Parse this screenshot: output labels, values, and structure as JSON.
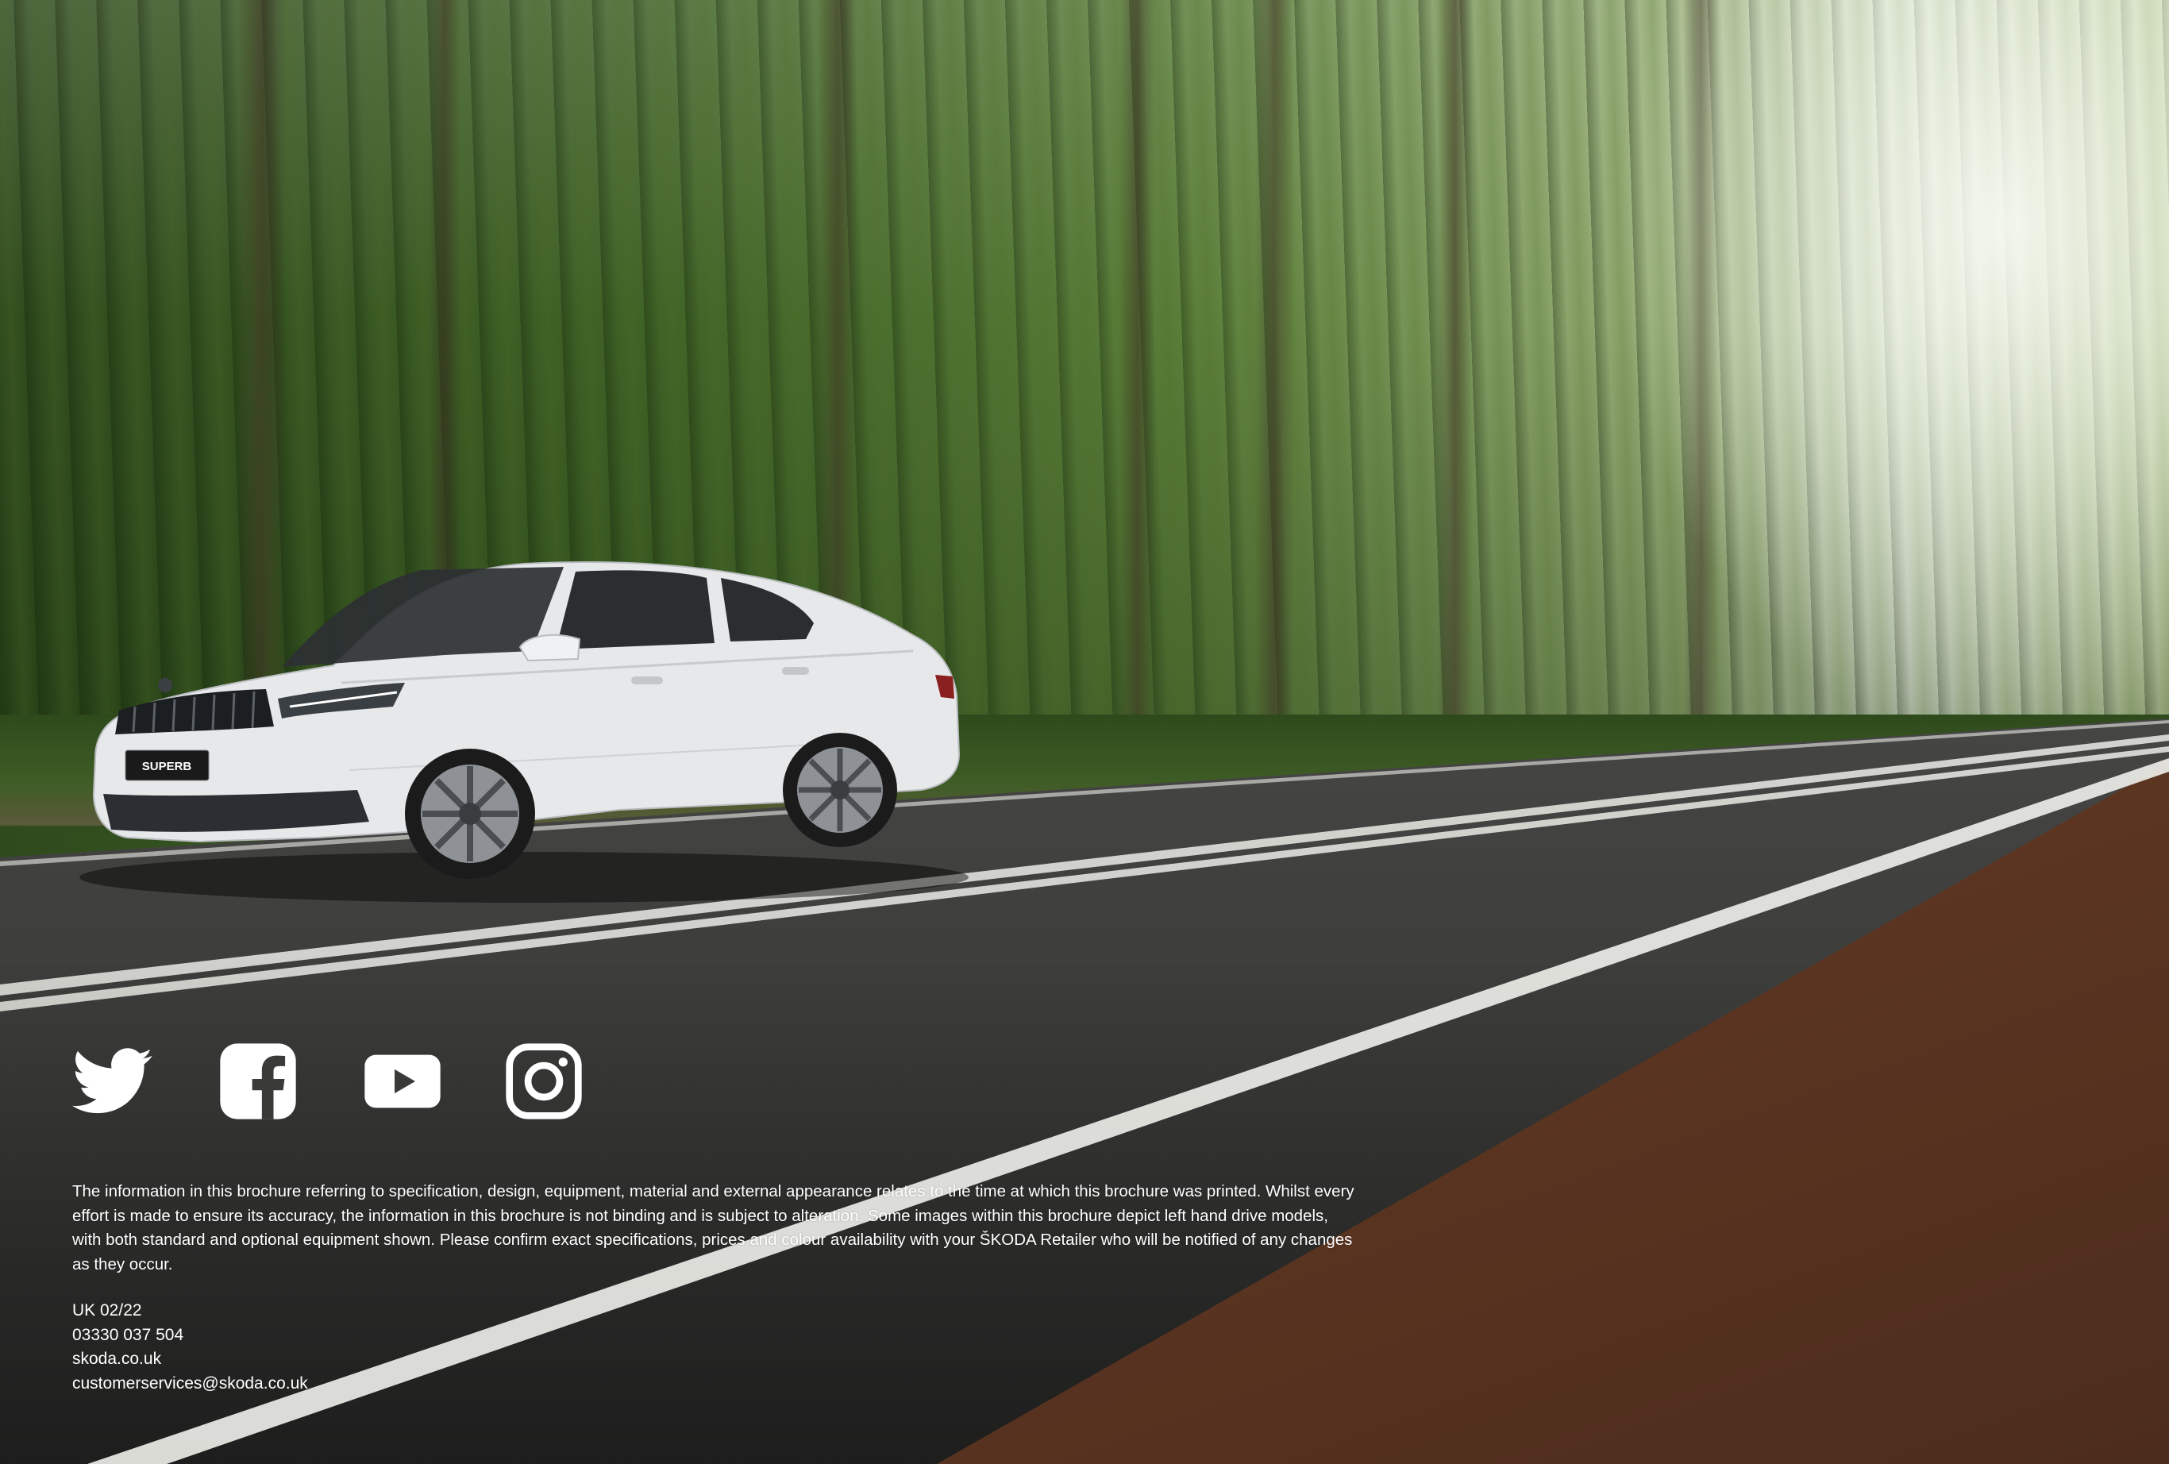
{
  "disclaimer": "The information in this brochure referring to specification, design, equipment, material and external appearance relates to the time at which this brochure was printed. Whilst every effort is made to ensure its accuracy, the information in this brochure is not binding and is subject to alteration. Some images within this brochure depict left hand drive models, with both standard and optional equipment shown. Please confirm exact specifications, prices and colour availability with your ŠKODA Retailer who will be notified of any changes as they occur.",
  "contact": {
    "edition": "UK 02/22",
    "phone": "03330 037 504",
    "website": "skoda.co.uk",
    "email": "customerservices@skoda.co.uk"
  },
  "car": {
    "plate_text": "SUPERB",
    "body_color": "#e6e8ea"
  },
  "social_icons": [
    "twitter-icon",
    "facebook-icon",
    "youtube-icon",
    "instagram-icon"
  ]
}
